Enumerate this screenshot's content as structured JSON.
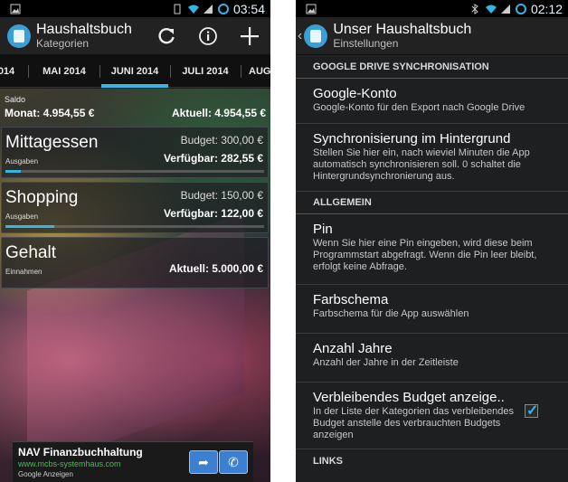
{
  "left": {
    "status": {
      "time": "03:54"
    },
    "actionbar": {
      "title": "Haushaltsbuch",
      "subtitle": "Kategorien"
    },
    "tabs": [
      "014",
      "MAI 2014",
      "JUNI 2014",
      "JULI 2014",
      "AUG"
    ],
    "selected_tab": "JUNI 2014",
    "saldo": {
      "label": "Saldo",
      "monat": "Monat: 4.954,55 €",
      "aktuell": "Aktuell: 4.954,55 €"
    },
    "categories": [
      {
        "name": "Mittagessen",
        "type": "Ausgaben",
        "budget": "Budget: 300,00 €",
        "available": "Verfügbar: 282,55 €",
        "progress": 0.06
      },
      {
        "name": "Shopping",
        "type": "Ausgaben",
        "budget": "Budget: 150,00 €",
        "available": "Verfügbar: 122,00 €",
        "progress": 0.19
      },
      {
        "name": "Gehalt",
        "type": "Einnahmen",
        "current": "Aktuell: 5.000,00 €"
      }
    ],
    "ad": {
      "title": "NAV Finanzbuchhaltung",
      "url": "www.mcbs-systemhaus.com",
      "label": "Google Anzeigen"
    },
    "colors": {
      "accent": "#33b5e5"
    }
  },
  "right": {
    "status": {
      "time": "02:12"
    },
    "actionbar": {
      "title": "Unser Haushaltsbuch",
      "subtitle": "Einstellungen"
    },
    "sections": {
      "sync": "GOOGLE DRIVE SYNCHRONISATION",
      "general": "ALLGEMEIN",
      "links": "LINKS"
    },
    "prefs": {
      "google_account": {
        "title": "Google-Konto",
        "summary": "Google-Konto für den Export nach Google Drive"
      },
      "background_sync": {
        "title": "Synchronisierung im Hintergrund",
        "summary": "Stellen Sie hier ein, nach wieviel Minuten die App automatisch synchronisieren soll. 0 schaltet die Hintergrundsynchronierung aus."
      },
      "pin": {
        "title": "Pin",
        "summary": "Wenn Sie hier eine Pin eingeben, wird diese beim Programmstart abgefragt. Wenn die Pin leer bleibt, erfolgt keine Abfrage."
      },
      "color_scheme": {
        "title": "Farbschema",
        "summary": "Farbschema für die App auswählen"
      },
      "years": {
        "title": "Anzahl Jahre",
        "summary": "Anzahl der Jahre in der Zeitleiste"
      },
      "remaining_budget": {
        "title": "Verbleibendes Budget anzeige..",
        "summary": "In der Liste der Kategorien das verbleibendes Budget anstelle des verbrauchten Budgets anzeigen",
        "checked": true
      }
    }
  }
}
